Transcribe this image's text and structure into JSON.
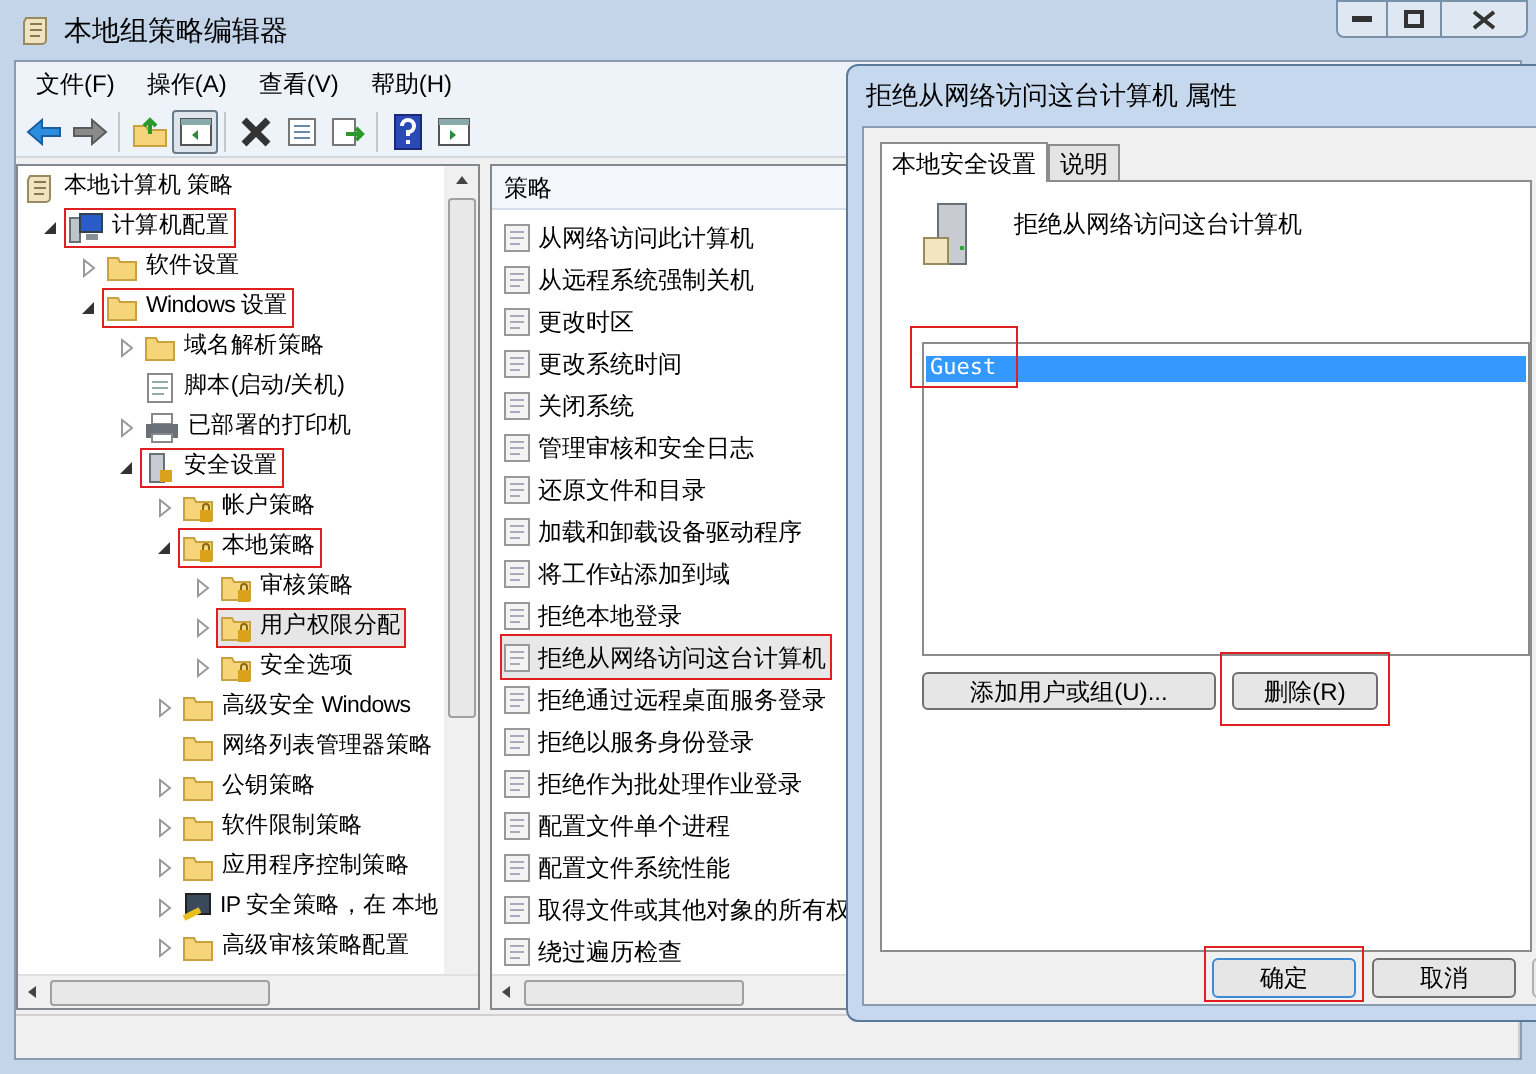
{
  "window": {
    "title": "本地组策略编辑器"
  },
  "menu": [
    {
      "label": "文件(F)"
    },
    {
      "label": "操作(A)"
    },
    {
      "label": "查看(V)"
    },
    {
      "label": "帮助(H)"
    }
  ],
  "toolbar": [
    {
      "kind": "back"
    },
    {
      "kind": "forward"
    },
    {
      "kind": "sep"
    },
    {
      "kind": "up"
    },
    {
      "kind": "tree",
      "pressed": true
    },
    {
      "kind": "sep"
    },
    {
      "kind": "delete"
    },
    {
      "kind": "properties"
    },
    {
      "kind": "export"
    },
    {
      "kind": "sep"
    },
    {
      "kind": "help"
    },
    {
      "kind": "view"
    }
  ],
  "tree": {
    "items": [
      {
        "label": "本地计算机 策略",
        "kind": "scroll",
        "selected": false,
        "highlighted": false,
        "children": [
          {
            "label": "计算机配置",
            "kind": "computer",
            "expanded": true,
            "selected": false,
            "highlighted": true,
            "children": [
              {
                "label": "软件设置",
                "kind": "folder",
                "expanded": false,
                "selected": false,
                "highlighted": false
              },
              {
                "label": "Windows 设置",
                "kind": "folder",
                "expanded": true,
                "selected": false,
                "highlighted": true,
                "children": [
                  {
                    "label": "域名解析策略",
                    "kind": "folder",
                    "expanded": false,
                    "selected": false,
                    "highlighted": false
                  },
                  {
                    "label": "脚本(启动/关机)",
                    "kind": "script",
                    "selected": false,
                    "highlighted": false
                  },
                  {
                    "label": "已部署的打印机",
                    "kind": "printer",
                    "expanded": false,
                    "selected": false,
                    "highlighted": false
                  },
                  {
                    "label": "安全设置",
                    "kind": "security",
                    "expanded": true,
                    "selected": false,
                    "highlighted": true,
                    "children": [
                      {
                        "label": "帐户策略",
                        "kind": "lockfolder",
                        "expanded": false,
                        "selected": false,
                        "highlighted": false
                      },
                      {
                        "label": "本地策略",
                        "kind": "lockfolder",
                        "expanded": true,
                        "selected": false,
                        "highlighted": true,
                        "children": [
                          {
                            "label": "审核策略",
                            "kind": "lockfolder",
                            "expanded": false,
                            "selected": false,
                            "highlighted": false
                          },
                          {
                            "label": "用户权限分配",
                            "kind": "lockfolder",
                            "expanded": false,
                            "selected": true,
                            "highlighted": true
                          },
                          {
                            "label": "安全选项",
                            "kind": "lockfolder",
                            "expanded": false,
                            "selected": false,
                            "highlighted": false
                          }
                        ]
                      },
                      {
                        "label": "高级安全 Windows",
                        "kind": "folder",
                        "expanded": false,
                        "selected": false,
                        "highlighted": false
                      },
                      {
                        "label": "网络列表管理器策略",
                        "kind": "folder",
                        "selected": false,
                        "highlighted": false
                      },
                      {
                        "label": "公钥策略",
                        "kind": "folder",
                        "expanded": false,
                        "selected": false,
                        "highlighted": false
                      },
                      {
                        "label": "软件限制策略",
                        "kind": "folder",
                        "expanded": false,
                        "selected": false,
                        "highlighted": false
                      },
                      {
                        "label": "应用程序控制策略",
                        "kind": "folder",
                        "expanded": false,
                        "selected": false,
                        "highlighted": false
                      },
                      {
                        "label": "IP 安全策略，在 本地",
                        "kind": "ipsec",
                        "expanded": false,
                        "selected": false,
                        "highlighted": false
                      },
                      {
                        "label": "高级审核策略配置",
                        "kind": "folder",
                        "expanded": false,
                        "selected": false,
                        "highlighted": false
                      }
                    ]
                  }
                ]
              }
            ]
          }
        ]
      }
    ]
  },
  "policies": {
    "column": "策略",
    "rows": [
      {
        "label": "从网络访问此计算机",
        "selected": false,
        "highlighted": false
      },
      {
        "label": "从远程系统强制关机",
        "selected": false,
        "highlighted": false
      },
      {
        "label": "更改时区",
        "selected": false,
        "highlighted": false
      },
      {
        "label": "更改系统时间",
        "selected": false,
        "highlighted": false
      },
      {
        "label": "关闭系统",
        "selected": false,
        "highlighted": false
      },
      {
        "label": "管理审核和安全日志",
        "selected": false,
        "highlighted": false
      },
      {
        "label": "还原文件和目录",
        "selected": false,
        "highlighted": false
      },
      {
        "label": "加载和卸载设备驱动程序",
        "selected": false,
        "highlighted": false
      },
      {
        "label": "将工作站添加到域",
        "selected": false,
        "highlighted": false
      },
      {
        "label": "拒绝本地登录",
        "selected": false,
        "highlighted": false
      },
      {
        "label": "拒绝从网络访问这台计算机",
        "selected": true,
        "highlighted": true
      },
      {
        "label": "拒绝通过远程桌面服务登录",
        "selected": false,
        "highlighted": false
      },
      {
        "label": "拒绝以服务身份登录",
        "selected": false,
        "highlighted": false
      },
      {
        "label": "拒绝作为批处理作业登录",
        "selected": false,
        "highlighted": false
      },
      {
        "label": "配置文件单个进程",
        "selected": false,
        "highlighted": false
      },
      {
        "label": "配置文件系统性能",
        "selected": false,
        "highlighted": false
      },
      {
        "label": "取得文件或其他对象的所有权",
        "selected": false,
        "highlighted": false
      },
      {
        "label": "绕过遍历检查",
        "selected": false,
        "highlighted": false
      }
    ]
  },
  "dialog": {
    "title": "拒绝从网络访问这台计算机 属性",
    "tabs": [
      {
        "label": "本地安全设置",
        "selected": true
      },
      {
        "label": "说明",
        "selected": false
      }
    ],
    "heading": "拒绝从网络访问这台计算机",
    "accounts": [
      {
        "label": "Guest",
        "selected": true,
        "highlighted": true
      }
    ],
    "buttons": [
      {
        "label": "添加用户或组(U)...",
        "highlighted": false
      },
      {
        "label": "删除(R)",
        "highlighted": true
      }
    ],
    "footer_buttons": [
      {
        "label": "确定",
        "highlighted": true,
        "default": true
      },
      {
        "label": "取消",
        "highlighted": false,
        "default": false
      }
    ]
  }
}
